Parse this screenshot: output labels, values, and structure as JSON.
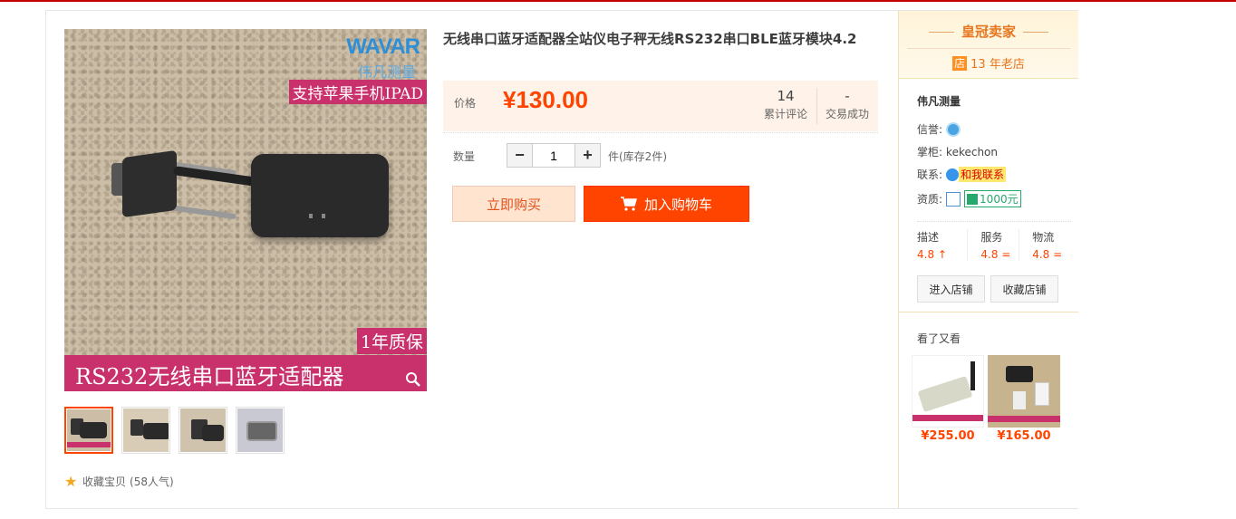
{
  "gallery": {
    "brand_logo": "WAVAR",
    "brand_sub": "伟凡测量",
    "ipad_tag": "支持苹果手机IPAD",
    "warranty_tag": "1年质保",
    "adapter_tag": "RS232无线串口蓝牙适配器"
  },
  "favorite": {
    "label": "收藏宝贝",
    "count": "(58人气)"
  },
  "product": {
    "title": "无线串口蓝牙适配器全站仪电子秤无线RS232串口BLE蓝牙模块4.2",
    "price_label": "价格",
    "price": "¥130.00",
    "reviews_count": "14",
    "reviews_label": "累计评论",
    "deals_count": "-",
    "deals_label": "交易成功",
    "qty_label": "数量",
    "qty_value": "1",
    "stock": "件(库存2件)",
    "buy_now": "立即购买",
    "add_cart": "加入购物车"
  },
  "seller": {
    "crown": "皇冠卖家",
    "dian_icon": "店",
    "years": "13 年老店",
    "shop_name": "伟凡测量",
    "credit_label": "信誉:",
    "keeper_label": "掌柜:",
    "keeper": "kekechon",
    "contact_label": "联系:",
    "contact_text": "和我联系",
    "qual_label": "资质:",
    "deposit": "1000元",
    "ratings": [
      {
        "label": "描述",
        "value": "4.8 ↑"
      },
      {
        "label": "服务",
        "value": "4.8 ="
      },
      {
        "label": "物流",
        "value": "4.8 ="
      }
    ],
    "enter_shop": "进入店铺",
    "fav_shop": "收藏店铺"
  },
  "seen": {
    "title": "看了又看",
    "items": [
      {
        "price": "¥255.00"
      },
      {
        "price": "¥165.00"
      }
    ]
  }
}
